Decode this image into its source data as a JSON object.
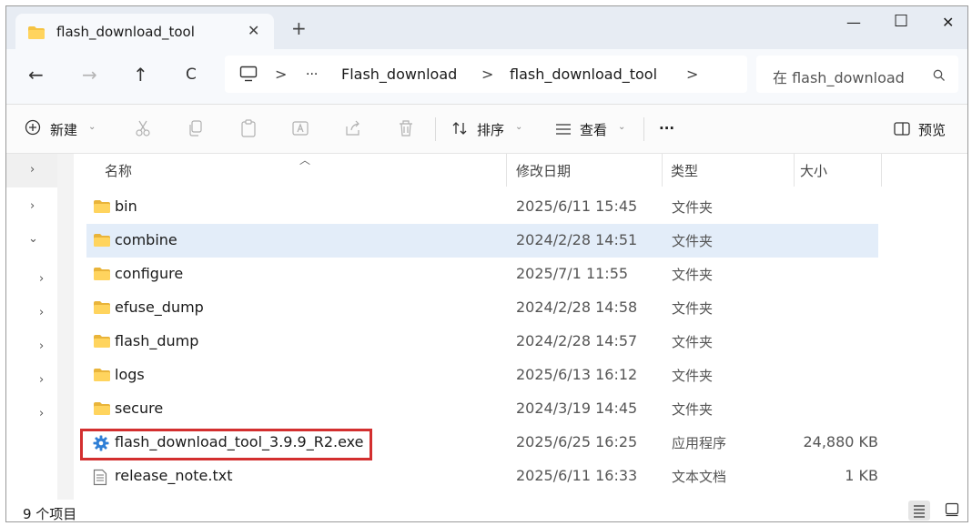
{
  "window": {
    "tab_title": "flash_download_tool",
    "tab_close": "✕",
    "new_tab": "+",
    "minimize": "—",
    "maximize": "☐",
    "close": "✕"
  },
  "nav": {
    "back": "←",
    "forward": "→",
    "up": "↑",
    "refresh": "C"
  },
  "address": {
    "more": "···",
    "crumbs": [
      "Flash_download",
      "flash_download_tool"
    ],
    "chevron": ">"
  },
  "search": {
    "placeholder": "在 flash_download"
  },
  "toolbar": {
    "new_label": "新建",
    "sort_label": "排序",
    "view_label": "查看",
    "more": "···",
    "preview_label": "预览"
  },
  "columns": {
    "name": "名称",
    "date": "修改日期",
    "type": "类型",
    "size": "大小"
  },
  "files": [
    {
      "name": "bin",
      "date": "2025/6/11 15:45",
      "type": "文件夹",
      "size": "",
      "icon": "folder-icon"
    },
    {
      "name": "combine",
      "date": "2024/2/28 14:51",
      "type": "文件夹",
      "size": "",
      "icon": "folder-icon"
    },
    {
      "name": "configure",
      "date": "2025/7/1 11:55",
      "type": "文件夹",
      "size": "",
      "icon": "folder-icon"
    },
    {
      "name": "efuse_dump",
      "date": "2024/2/28 14:58",
      "type": "文件夹",
      "size": "",
      "icon": "folder-icon"
    },
    {
      "name": "flash_dump",
      "date": "2024/2/28 14:57",
      "type": "文件夹",
      "size": "",
      "icon": "folder-icon"
    },
    {
      "name": "logs",
      "date": "2025/6/13 16:12",
      "type": "文件夹",
      "size": "",
      "icon": "folder-icon"
    },
    {
      "name": "secure",
      "date": "2024/3/19 14:45",
      "type": "文件夹",
      "size": "",
      "icon": "folder-icon"
    },
    {
      "name": "flash_download_tool_3.9.9_R2.exe",
      "date": "2025/6/25 16:25",
      "type": "应用程序",
      "size": "24,880 KB",
      "icon": "gear-app-icon"
    },
    {
      "name": "release_note.txt",
      "date": "2025/6/11 16:33",
      "type": "文本文档",
      "size": "1 KB",
      "icon": "text-file-icon"
    }
  ],
  "status": {
    "item_count": "9 个项目"
  },
  "colors": {
    "accent": "#1e6fd9",
    "folder": "#f5c342",
    "highlight": "#d32f2f",
    "selected_row": "#e3edf9"
  }
}
